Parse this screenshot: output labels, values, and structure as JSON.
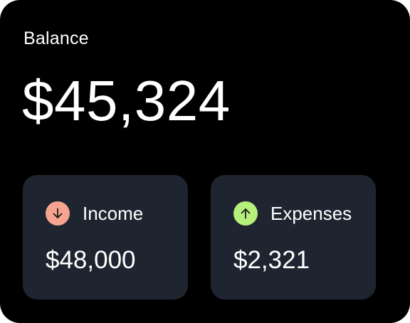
{
  "balance": {
    "label": "Balance",
    "amount": "$45,324"
  },
  "stats": {
    "income": {
      "label": "Income",
      "value": "$48,000",
      "icon": "arrow-down-icon",
      "icon_color": "#f6a48f"
    },
    "expenses": {
      "label": "Expenses",
      "value": "$2,321",
      "icon": "arrow-up-icon",
      "icon_color": "#b6f07a"
    }
  },
  "colors": {
    "card_background": "#000000",
    "stat_card_background": "#1f2530",
    "text": "#ffffff"
  }
}
